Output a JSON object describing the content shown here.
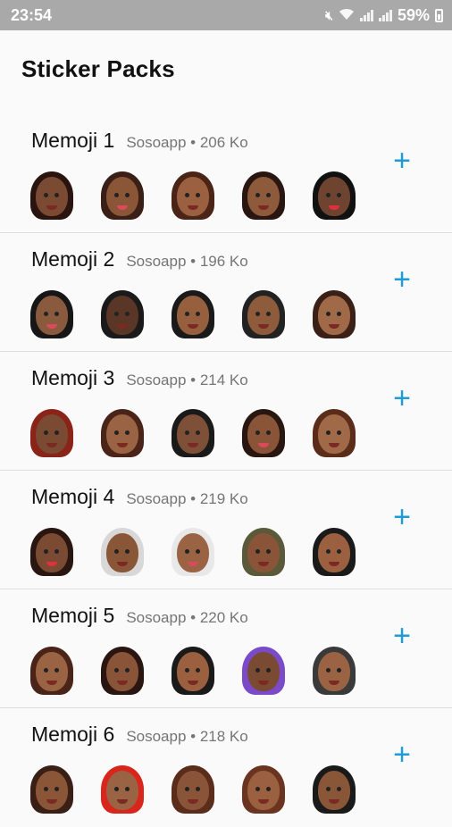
{
  "status_bar": {
    "time": "23:54",
    "battery_percent": "59%",
    "icons": [
      "mute-icon",
      "wifi-icon",
      "signal-icon",
      "signal-icon",
      "battery-icon"
    ]
  },
  "page": {
    "title": "Sticker Packs"
  },
  "add_icon": "+",
  "colors": {
    "accent": "#1f9bd8",
    "status_bar": "#a9a9a9"
  },
  "packs": [
    {
      "name": "Memoji 1",
      "meta": "Sosoapp • 206 Ko"
    },
    {
      "name": "Memoji 2",
      "meta": "Sosoapp • 196 Ko"
    },
    {
      "name": "Memoji 3",
      "meta": "Sosoapp • 214 Ko"
    },
    {
      "name": "Memoji 4",
      "meta": "Sosoapp • 219 Ko"
    },
    {
      "name": "Memoji 5",
      "meta": "Sosoapp • 220 Ko"
    },
    {
      "name": "Memoji 6",
      "meta": "Sosoapp • 218 Ko"
    }
  ]
}
